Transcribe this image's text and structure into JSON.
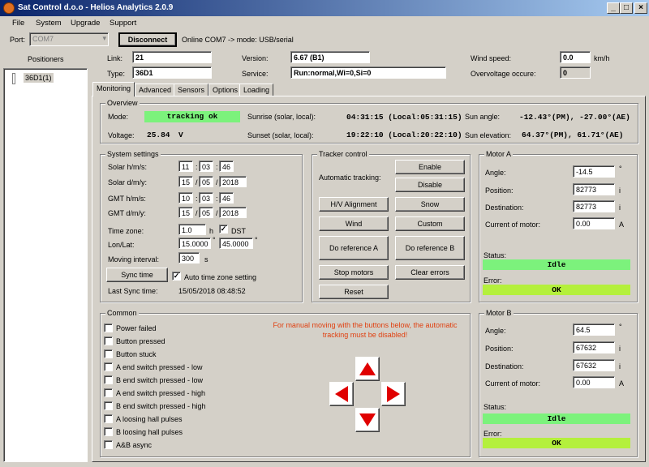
{
  "window": {
    "title": "Sat Control d.o.o - Helios Analytics 2.0.9",
    "minimize": "_",
    "maximize": "□",
    "close": "×"
  },
  "menu": [
    "File",
    "System",
    "Upgrade",
    "Support"
  ],
  "conn": {
    "port_label": "Port:",
    "port_value": "COM7",
    "disconnect": "Disconnect",
    "status": "Online COM7 -> mode: USB/serial"
  },
  "positioners": {
    "header": "Positioners",
    "item": "36D1(1)"
  },
  "info": {
    "link_label": "Link:",
    "link_value": "21",
    "type_label": "Type:",
    "type_value": "36D1",
    "version_label": "Version:",
    "version_value": "6.67 (B1)",
    "service_label": "Service:",
    "service_value": "Run:normal,Wi=0,Si=0",
    "wind_label": "Wind speed:",
    "wind_value": "0.0",
    "wind_unit": "km/h",
    "overvolt_label": "Overvoltage occure:",
    "overvolt_value": "0"
  },
  "tabs": [
    "Monitoring",
    "Advanced",
    "Sensors",
    "Options",
    "Loading"
  ],
  "overview": {
    "title": "Overview",
    "mode_label": "Mode:",
    "mode_value": "tracking ok",
    "voltage_label": "Voltage:",
    "voltage_value": "25.84",
    "voltage_unit": "V",
    "sunrise_label": "Sunrise (solar, local):",
    "sunrise_value": "04:31:15 (Local:05:31:15)",
    "sunset_label": "Sunset (solar, local):",
    "sunset_value": "19:22:10 (Local:20:22:10)",
    "sunangle_label": "Sun angle:",
    "sunangle_value": "-12.43°(PM), -27.00°(AE)",
    "sunelev_label": "Sun elevation:",
    "sunelev_value": "64.37°(PM), 61.71°(AE)"
  },
  "system": {
    "title": "System settings",
    "solar_hms_label": "Solar h/m/s:",
    "solar_h": "11",
    "solar_m": "03",
    "solar_s": "46",
    "solar_dmy_label": "Solar d/m/y:",
    "solar_d": "15",
    "solar_mo": "05",
    "solar_y": "2018",
    "gmt_hms_label": "GMT h/m/s:",
    "gmt_h": "10",
    "gmt_m": "03",
    "gmt_s": "46",
    "gmt_dmy_label": "GMT d/m/y:",
    "gmt_d": "15",
    "gmt_mo": "05",
    "gmt_y": "2018",
    "colon": ":",
    "slash": "/",
    "tz_label": "Time zone:",
    "tz_value": "1.0",
    "tz_unit": "h",
    "dst_label": "DST",
    "lonlat_label": "Lon/Lat:",
    "lon_value": "15.0000",
    "lat_value": "45.0000",
    "deg": "°",
    "moving_label": "Moving interval:",
    "moving_value": "300",
    "moving_unit": "s",
    "sync_button": "Sync time",
    "auto_tz_label": "Auto time zone setting",
    "last_sync_label": "Last Sync time:",
    "last_sync_value": "15/05/2018 08:48:52"
  },
  "tracker": {
    "title": "Tracker control",
    "auto_label": "Automatic tracking:",
    "enable": "Enable",
    "disable": "Disable",
    "hv": "H/V Alignment",
    "snow": "Snow",
    "wind": "Wind",
    "custom": "Custom",
    "refA": "Do reference A",
    "refB": "Do reference B",
    "stop": "Stop motors",
    "clear": "Clear errors",
    "reset": "Reset"
  },
  "motorA": {
    "title": "Motor A",
    "angle_label": "Angle:",
    "angle_value": "-14.5",
    "angle_unit": "°",
    "pos_label": "Position:",
    "pos_value": "82773",
    "pos_unit": "i",
    "dest_label": "Destination:",
    "dest_value": "82773",
    "dest_unit": "i",
    "current_label": "Current of motor:",
    "current_value": "0.00",
    "current_unit": "A",
    "status_label": "Status:",
    "status_value": "Idle",
    "error_label": "Error:",
    "error_value": "OK"
  },
  "motorB": {
    "title": "Motor B",
    "angle_label": "Angle:",
    "angle_value": "64.5",
    "angle_unit": "°",
    "pos_label": "Position:",
    "pos_value": "67632",
    "pos_unit": "i",
    "dest_label": "Destination:",
    "dest_value": "67632",
    "dest_unit": "i",
    "current_label": "Current of motor:",
    "current_value": "0.00",
    "current_unit": "A",
    "status_label": "Status:",
    "status_value": "Idle",
    "error_label": "Error:",
    "error_value": "OK"
  },
  "common": {
    "title": "Common",
    "warning": "For manual moving with the buttons below, the automatic tracking must be disabled!",
    "checks": [
      "Power failed",
      "Button pressed",
      "Button stuck",
      "A end switch pressed - low",
      "B end switch pressed - low",
      "A end switch pressed - high",
      "B end switch pressed - high",
      "A loosing hall pulses",
      "B loosing hall pulses",
      "A&B async"
    ]
  },
  "colors": {
    "title_start": "#0a246a",
    "status_green": "#7cf27c",
    "error_lime": "#b4f03c",
    "warning": "#e04010",
    "arrow_red": "#e00000"
  }
}
